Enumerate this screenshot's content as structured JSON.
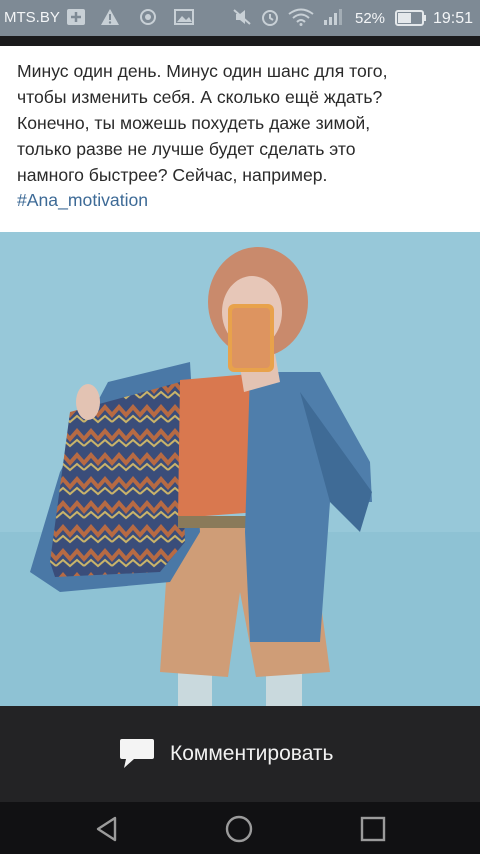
{
  "status_bar": {
    "carrier": "MTS.BY",
    "battery_percent": "52%",
    "time": "19:51",
    "icons": [
      "plus-icon",
      "warning-icon",
      "sync-icon",
      "image-icon",
      "mute-icon",
      "alarm-icon",
      "wifi-icon",
      "signal-icon",
      "battery-icon"
    ]
  },
  "post": {
    "text": "Минус один день. Минус один шанс для того,\nчтобы изменить себя. А сколько ещё ждать?\nКонечно, ты можешь похудеть даже зимой,\nтолько разве не лучше будет сделать это\nнамного быстрее? Сейчас, например.",
    "hashtag": "#Ana_motivation"
  },
  "actions": {
    "comment_label": "Комментировать"
  },
  "navigation": {
    "buttons": [
      "back-icon",
      "home-icon",
      "recents-icon"
    ]
  },
  "colors": {
    "status_bar": "#7e8a95",
    "hashtag": "#3d6a96",
    "comment_bar": "#232325",
    "nav_bar": "#111113",
    "photo_background": "#8fc3d6"
  }
}
